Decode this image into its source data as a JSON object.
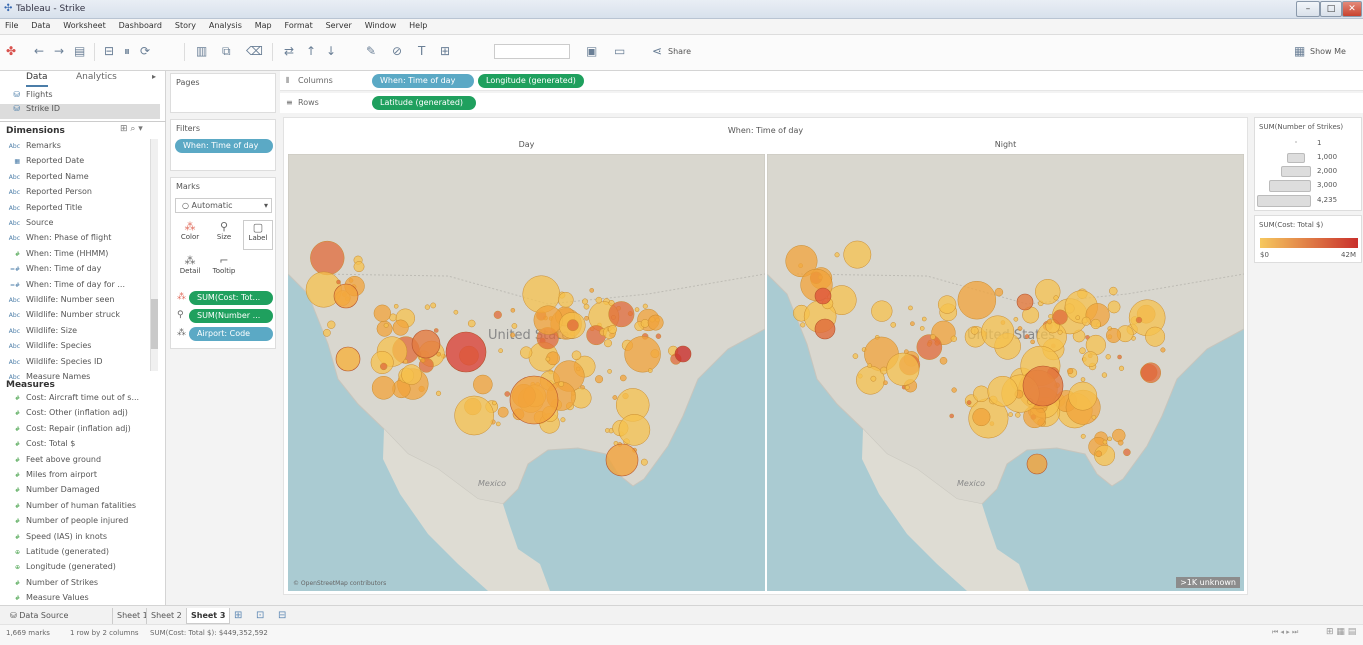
{
  "window": {
    "title": "Tableau - Strike",
    "controls": [
      "–",
      "□",
      "✕"
    ]
  },
  "menu": [
    "File",
    "Data",
    "Worksheet",
    "Dashboard",
    "Story",
    "Analysis",
    "Map",
    "Format",
    "Server",
    "Window",
    "Help"
  ],
  "toolbar": {
    "share_label": "Share",
    "show_me_label": "Show Me"
  },
  "data_pane": {
    "tab_data": "Data",
    "tab_analytics": "Analytics",
    "sources": [
      "Flights",
      "Strike ID"
    ],
    "dimensions_label": "Dimensions",
    "measures_label": "Measures",
    "dimensions": [
      {
        "icon": "Abc",
        "label": "Remarks"
      },
      {
        "icon": "date",
        "label": "Reported Date"
      },
      {
        "icon": "Abc",
        "label": "Reported Name"
      },
      {
        "icon": "Abc",
        "label": "Reported Person"
      },
      {
        "icon": "Abc",
        "label": "Reported Title"
      },
      {
        "icon": "Abc",
        "label": "Source"
      },
      {
        "icon": "Abc",
        "label": "When: Phase of flight"
      },
      {
        "icon": "#",
        "label": "When: Time (HHMM)"
      },
      {
        "icon": "calc",
        "label": "When: Time of day"
      },
      {
        "icon": "calc",
        "label": "When: Time of day for ..."
      },
      {
        "icon": "Abc",
        "label": "Wildlife: Number seen"
      },
      {
        "icon": "Abc",
        "label": "Wildlife: Number struck"
      },
      {
        "icon": "Abc",
        "label": "Wildlife: Size"
      },
      {
        "icon": "Abc",
        "label": "Wildlife: Species"
      },
      {
        "icon": "Abc",
        "label": "Wildlife: Species ID"
      },
      {
        "icon": "Abc",
        "label": "Measure Names"
      }
    ],
    "measures": [
      {
        "icon": "#",
        "label": "Cost: Aircraft time out of s..."
      },
      {
        "icon": "#",
        "label": "Cost: Other (inflation adj)"
      },
      {
        "icon": "#",
        "label": "Cost: Repair (inflation adj)"
      },
      {
        "icon": "#",
        "label": "Cost: Total $"
      },
      {
        "icon": "#",
        "label": "Feet above ground"
      },
      {
        "icon": "#",
        "label": "Miles from airport"
      },
      {
        "icon": "#",
        "label": "Number Damaged"
      },
      {
        "icon": "#",
        "label": "Number of human fatalities"
      },
      {
        "icon": "#",
        "label": "Number of people injured"
      },
      {
        "icon": "#",
        "label": "Speed (IAS) in knots"
      },
      {
        "icon": "geo",
        "label": "Latitude (generated)"
      },
      {
        "icon": "geo",
        "label": "Longitude (generated)"
      },
      {
        "icon": "#",
        "label": "Number of Strikes"
      },
      {
        "icon": "#",
        "label": "Measure Values"
      }
    ]
  },
  "pages_label": "Pages",
  "filters": {
    "label": "Filters",
    "items": [
      "When: Time of day"
    ]
  },
  "marks": {
    "label": "Marks",
    "type": "Automatic",
    "buttons": [
      "Color",
      "Size",
      "Label",
      "Detail",
      "Tooltip"
    ],
    "fields": [
      "SUM(Cost: Tot...",
      "SUM(Number ...",
      "Airport: Code"
    ]
  },
  "shelves": {
    "columns_label": "Columns",
    "rows_label": "Rows",
    "columns": [
      "When: Time of day",
      "Longitude (generated)"
    ],
    "rows": [
      "Latitude (generated)"
    ]
  },
  "viz": {
    "header": "When: Time of day",
    "panels": [
      "Day",
      "Night"
    ],
    "map_labels": {
      "country": "United States",
      "mexico": "Mexico"
    },
    "attribution": "© OpenStreetMap contributors",
    "unknown_badge": ">1K unknown"
  },
  "legends": {
    "size_title": "SUM(Number of Strikes)",
    "size_values": [
      "1",
      "1,000",
      "2,000",
      "3,000",
      "4,235"
    ],
    "color_title": "SUM(Cost: Total $)",
    "color_min": "$0",
    "color_max": "42M",
    "color_low": "#f6c85f",
    "color_high": "#c9302c"
  },
  "sheet_tabs": [
    "Data Source",
    "Sheet 1",
    "Sheet 2",
    "Sheet 3"
  ],
  "active_sheet": "Sheet 3",
  "status": {
    "marks": "1,669 marks",
    "rows_cols": "1 row by 2 columns",
    "sum": "SUM(Cost: Total $): $449,352,592"
  }
}
